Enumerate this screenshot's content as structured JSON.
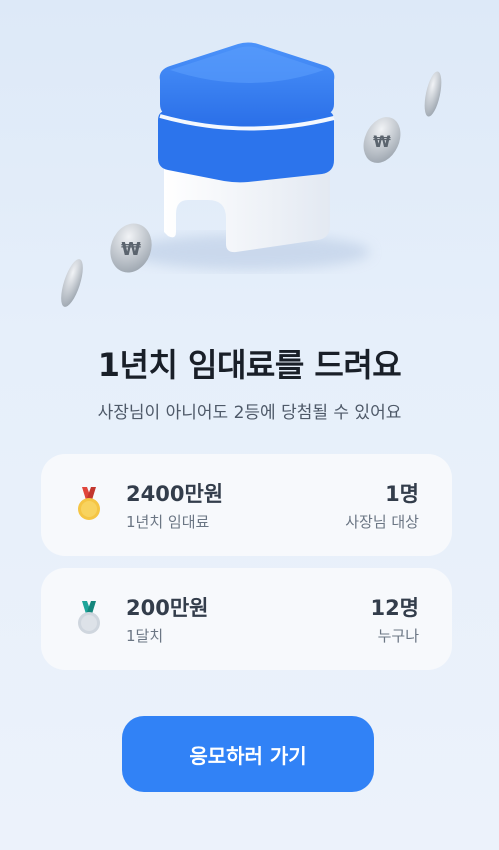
{
  "title": "1년치 임대료를 드려요",
  "subtitle": "사장님이 아니어도 2등에 당첨될 수 있어요",
  "prizes": [
    {
      "amount": "2400만원",
      "description": "1년치 임대료",
      "winners": "1명",
      "target": "사장님 대상",
      "medal": "gold-medal-icon"
    },
    {
      "amount": "200만원",
      "description": "1달치",
      "winners": "12명",
      "target": "누구나",
      "medal": "silver-medal-icon"
    }
  ],
  "cta_label": "응모하러 가기",
  "colors": {
    "accent": "#3182f6",
    "card": "#f7f9fc",
    "gold": "#f5c544",
    "silver": "#cfd6de"
  },
  "hero": {
    "coin_symbol": "₩"
  }
}
